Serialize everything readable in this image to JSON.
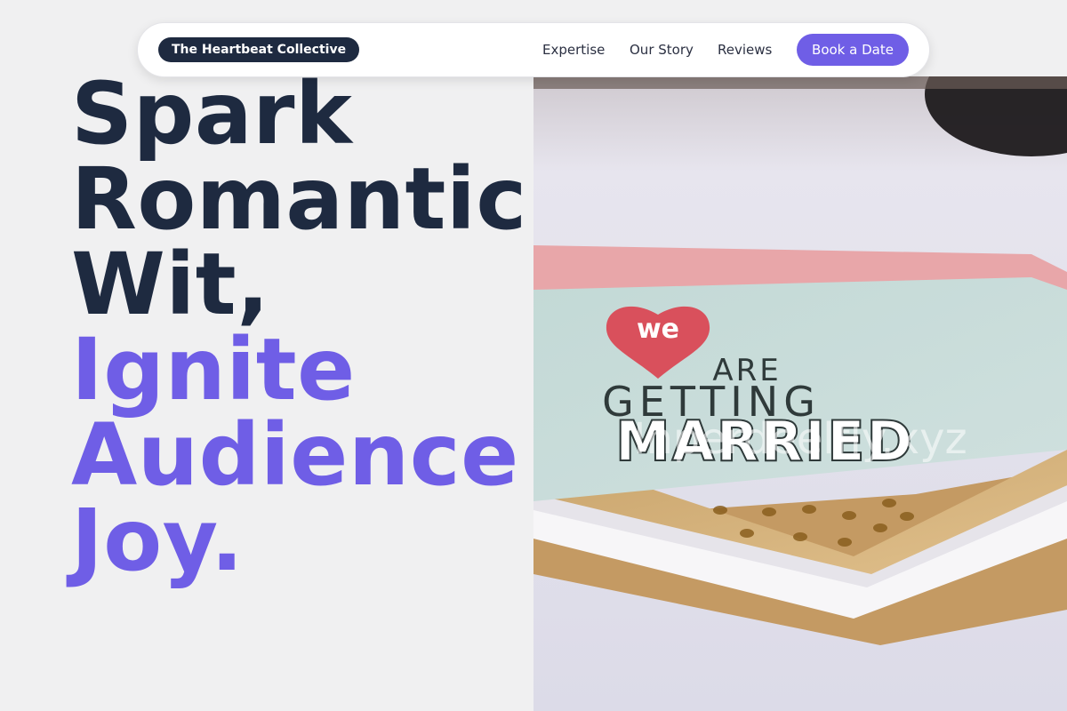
{
  "nav": {
    "brand": "The Heartbeat Collective",
    "links": [
      "Expertise",
      "Our Story",
      "Reviews"
    ],
    "cta": "Book a Date"
  },
  "hero": {
    "headline_lines": [
      "Spark",
      "Romantic",
      "Wit,"
    ],
    "accent_lines": [
      "Ignite",
      "Audience",
      "Joy."
    ]
  },
  "image": {
    "card_text": [
      "we",
      "ARE",
      "GETTING",
      "MARRIED"
    ],
    "watermark": "Inperdeelfly.xyz"
  },
  "colors": {
    "accent": "#6f5ee6",
    "dark": "#1e2a40",
    "background": "#f0f0f1",
    "card": "#c9dcd9",
    "heart": "#d9505c"
  }
}
